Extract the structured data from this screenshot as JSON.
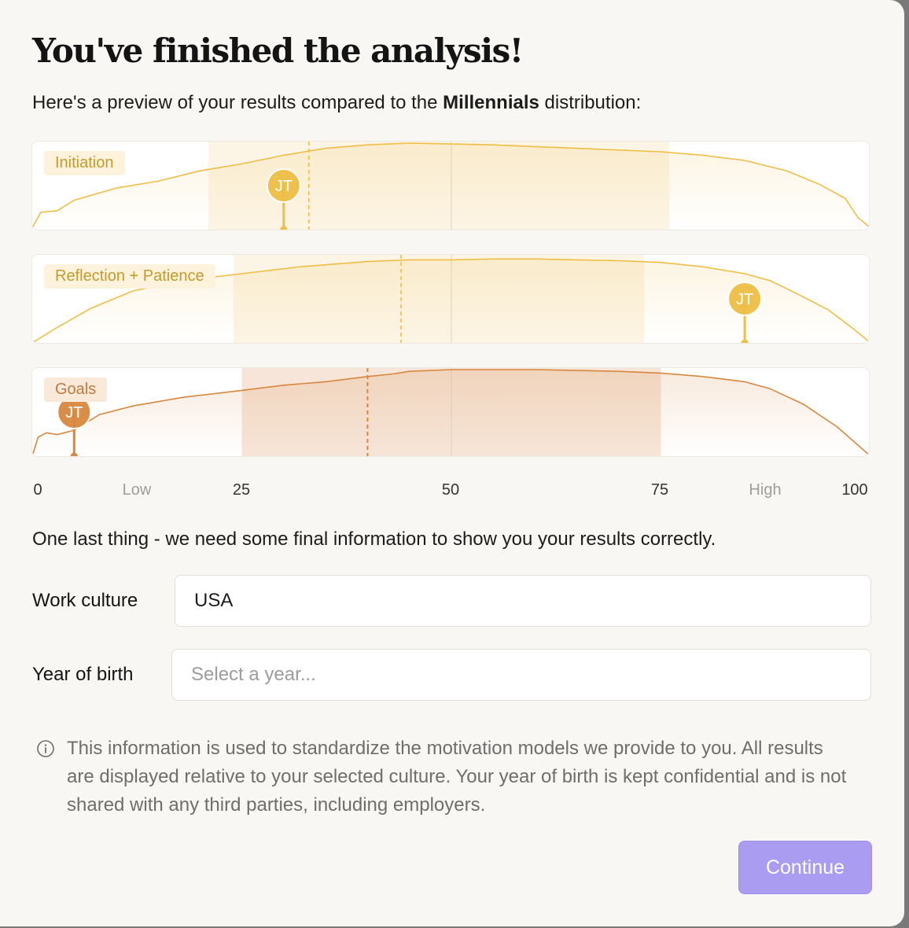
{
  "title": "You've finished the analysis!",
  "subtitle": {
    "prefix": "Here's a preview of your results compared to the ",
    "highlight": "Millennials",
    "suffix": " distribution:"
  },
  "chart_data": {
    "type": "area",
    "xlim": [
      0,
      100
    ],
    "ticks": [
      {
        "value": 0,
        "label": "0"
      },
      {
        "value": 12.5,
        "label": "Low"
      },
      {
        "value": 25,
        "label": "25"
      },
      {
        "value": 50,
        "label": "50"
      },
      {
        "value": 75,
        "label": "75"
      },
      {
        "value": 87.5,
        "label": "High"
      },
      {
        "value": 100,
        "label": "100"
      }
    ],
    "colors": {
      "light": "#eebe45",
      "dark": "#d7873e"
    },
    "series": [
      {
        "name": "Initiation",
        "style": "light",
        "marker_label": "JT",
        "user_score": 30,
        "median": 33,
        "band": [
          21,
          76
        ],
        "curve": [
          [
            0,
            2
          ],
          [
            1,
            20
          ],
          [
            3,
            22
          ],
          [
            5,
            34
          ],
          [
            10,
            48
          ],
          [
            15,
            56
          ],
          [
            20,
            68
          ],
          [
            25,
            76
          ],
          [
            30,
            86
          ],
          [
            35,
            94
          ],
          [
            40,
            98
          ],
          [
            45,
            100
          ],
          [
            50,
            99
          ],
          [
            55,
            98
          ],
          [
            60,
            96
          ],
          [
            65,
            94
          ],
          [
            70,
            92
          ],
          [
            75,
            90
          ],
          [
            80,
            86
          ],
          [
            85,
            80
          ],
          [
            90,
            68
          ],
          [
            94,
            52
          ],
          [
            97,
            36
          ],
          [
            98.5,
            14
          ],
          [
            100,
            2
          ]
        ]
      },
      {
        "name": "Reflection + Patience",
        "style": "light",
        "marker_label": "JT",
        "user_score": 85,
        "median": 44,
        "band": [
          24,
          73
        ],
        "curve": [
          [
            0,
            0
          ],
          [
            3,
            18
          ],
          [
            7,
            40
          ],
          [
            12,
            60
          ],
          [
            18,
            72
          ],
          [
            25,
            80
          ],
          [
            32,
            88
          ],
          [
            40,
            94
          ],
          [
            45,
            96
          ],
          [
            50,
            96
          ],
          [
            55,
            97
          ],
          [
            60,
            97
          ],
          [
            65,
            96
          ],
          [
            70,
            95
          ],
          [
            75,
            93
          ],
          [
            80,
            88
          ],
          [
            85,
            80
          ],
          [
            88,
            72
          ],
          [
            91,
            58
          ],
          [
            95,
            38
          ],
          [
            98,
            16
          ],
          [
            100,
            0
          ]
        ]
      },
      {
        "name": "Goals",
        "style": "dark",
        "marker_label": "JT",
        "user_score": 5,
        "median": 40,
        "band": [
          25,
          75
        ],
        "curve": [
          [
            0,
            0
          ],
          [
            0.7,
            22
          ],
          [
            1.7,
            27
          ],
          [
            3,
            25
          ],
          [
            5,
            30
          ],
          [
            8,
            48
          ],
          [
            12,
            58
          ],
          [
            18,
            68
          ],
          [
            25,
            76
          ],
          [
            30,
            82
          ],
          [
            35,
            86
          ],
          [
            40,
            92
          ],
          [
            43,
            95
          ],
          [
            45,
            98
          ],
          [
            50,
            100
          ],
          [
            55,
            100
          ],
          [
            60,
            100
          ],
          [
            65,
            99
          ],
          [
            70,
            98
          ],
          [
            75,
            96
          ],
          [
            80,
            92
          ],
          [
            85,
            86
          ],
          [
            88,
            78
          ],
          [
            92,
            60
          ],
          [
            96,
            34
          ],
          [
            100,
            0
          ]
        ]
      }
    ]
  },
  "final_info_text": "One last thing - we need some final information to show you your results correctly.",
  "form": {
    "work_culture": {
      "label": "Work culture",
      "value": "USA"
    },
    "year_of_birth": {
      "label": "Year of birth",
      "placeholder": "Select a year..."
    }
  },
  "info_text": "This information is used to standardize the motivation models we provide to you. All results are displayed relative to your selected culture. Your year of birth is kept confidential and is not shared with any third parties, including employers.",
  "continue_label": "Continue"
}
